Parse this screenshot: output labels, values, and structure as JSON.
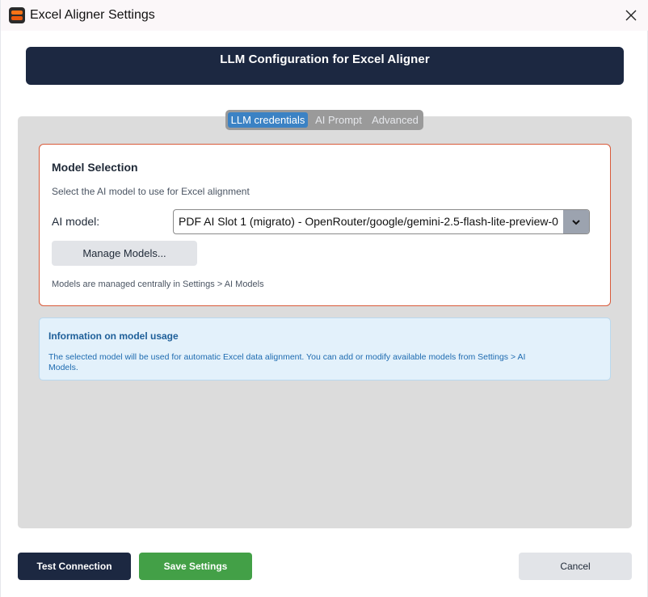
{
  "window": {
    "title": "Excel Aligner Settings",
    "icon": "app-logo-icon",
    "close_icon": "close-icon"
  },
  "header": {
    "title": "LLM Configuration for Excel Aligner"
  },
  "tabs": [
    {
      "label": "LLM credentials",
      "active": true
    },
    {
      "label": "AI Prompt",
      "active": false
    },
    {
      "label": "Advanced",
      "active": false
    }
  ],
  "model_selection": {
    "title": "Model Selection",
    "subtitle": "Select the AI model to use for Excel alignment",
    "model_label": "AI model:",
    "model_value": "PDF AI Slot 1 (migrato) - OpenRouter/google/gemini-2.5-flash-lite-preview-0",
    "dropdown_icon": "chevron-down-icon",
    "manage_button": "Manage Models...",
    "note": "Models are managed centrally in Settings > AI Models"
  },
  "info": {
    "title": "Information on model usage",
    "text": "The selected model will be used for automatic Excel data alignment. You can add or modify available models from Settings > AI Models."
  },
  "footer": {
    "test_button": "Test Connection",
    "save_button": "Save Settings",
    "cancel_button": "Cancel"
  },
  "colors": {
    "header_bg": "#1c2841",
    "tab_active": "#3b82c4",
    "card_border": "#d85a3a",
    "info_bg": "#e3f1fb",
    "info_text": "#1e6bb0",
    "save_button": "#43a047"
  }
}
